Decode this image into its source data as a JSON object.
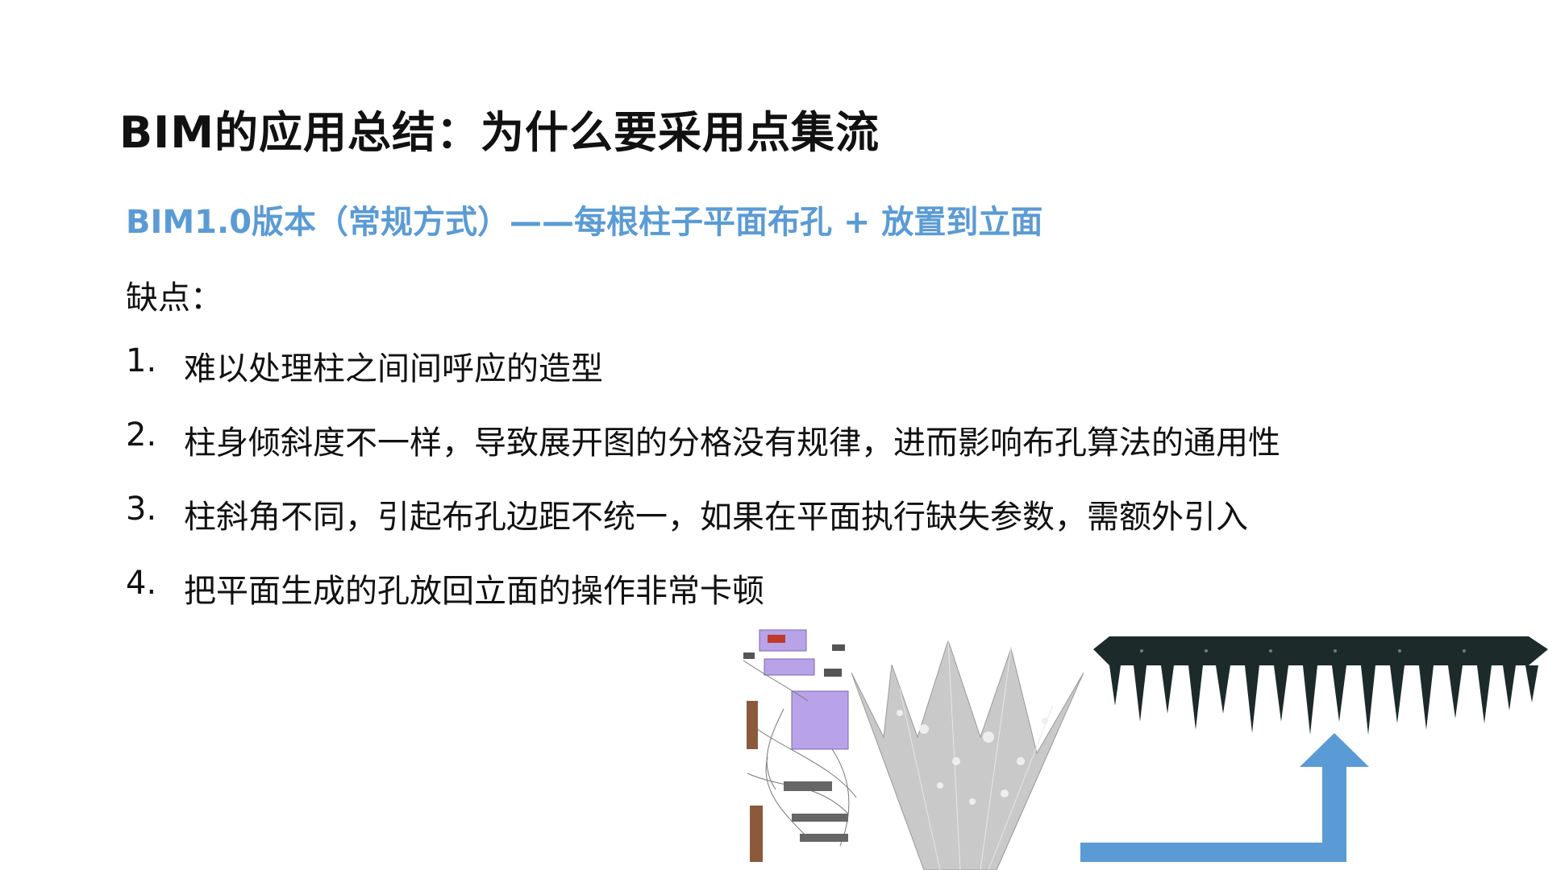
{
  "slide": {
    "title": "BIM的应用总结：为什么要采用点集流",
    "subtitle": "BIM1.0版本（常规方式）——每根柱子平面布孔 + 放置到立面",
    "section_label": "缺点：",
    "items": [
      {
        "num": "1.",
        "text": "难以处理柱之间间呼应的造型"
      },
      {
        "num": "2.",
        "text": "柱身倾斜度不一样，导致展开图的分格没有规律，进而影响布孔算法的通用性"
      },
      {
        "num": "3.",
        "text": "柱斜角不同，引起布孔边距不统一，如果在平面执行缺失参数，需额外引入"
      },
      {
        "num": "4.",
        "text": "把平面生成的孔放回立面的操作非常卡顿"
      }
    ]
  },
  "colors": {
    "accent": "#5b9bd5",
    "text": "#111111",
    "graph_group": "#b8a3e8",
    "panel_fill": "#c9c9c9",
    "facade_dark": "#1c2a2a",
    "arrow": "#5b9bd5"
  }
}
